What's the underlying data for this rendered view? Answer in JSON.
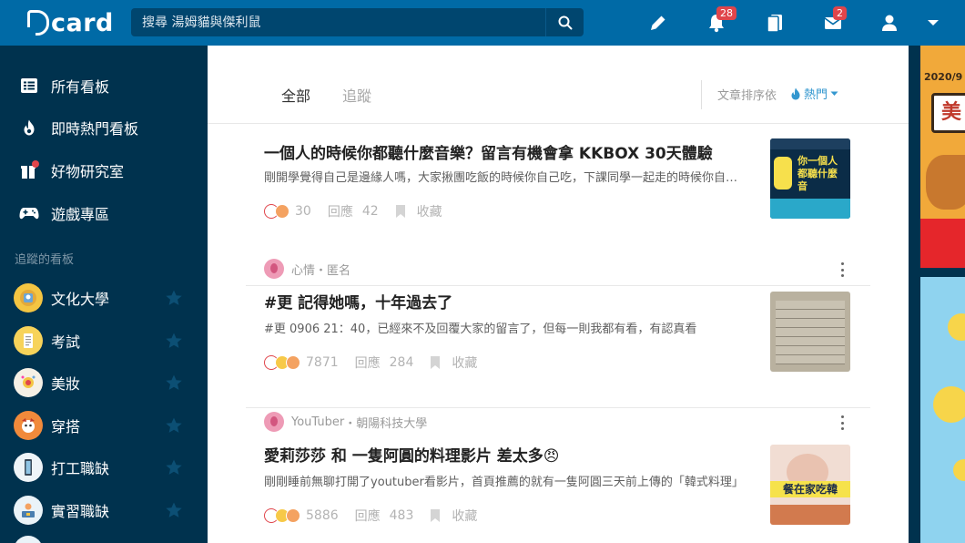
{
  "app": {
    "logo_text": "card"
  },
  "search": {
    "placeholder": "搜尋 湯姆貓與傑利鼠"
  },
  "header": {
    "notifications_count": "28",
    "messages_count": "2"
  },
  "sidebar": {
    "main_items": [
      {
        "label": "所有看板",
        "icon": "list-icon"
      },
      {
        "label": "即時熱門看板",
        "icon": "fire-icon"
      },
      {
        "label": "好物研究室",
        "icon": "gift-icon"
      },
      {
        "label": "遊戲專區",
        "icon": "gamepad-icon"
      }
    ],
    "section_title": "追蹤的看板",
    "forums": [
      {
        "label": "文化大學",
        "color": "#f4c542"
      },
      {
        "label": "考試",
        "color": "#f7d35a"
      },
      {
        "label": "美妝",
        "color": "#f5f0e6"
      },
      {
        "label": "穿搭",
        "color": "#f18a3b"
      },
      {
        "label": "打工職缺",
        "color": "#eef4f8"
      },
      {
        "label": "實習職缺",
        "color": "#eaf3f8"
      }
    ]
  },
  "tabs": {
    "all": "全部",
    "follow": "追蹤"
  },
  "sort": {
    "label": "文章排序依",
    "value": "熱門"
  },
  "posts": [
    {
      "forum": "",
      "author": "",
      "title": "一個人的時候你都聽什麼音樂？留言有機會拿 KKBOX 30天體驗",
      "excerpt": "剛開學覺得自己是邊緣人嗎，大家揪團吃飯的時候你自己吃，下課同學一起走的時候你自己走",
      "likes": "30",
      "reply_label": "回應",
      "comments": "42",
      "save_label": "收藏",
      "thumb_text": "你一個人都聽什麼音"
    },
    {
      "forum": "心情",
      "author": "匿名",
      "title": "#更 記得她嗎，十年過去了",
      "excerpt": "#更 0906 21：40，已經來不及回覆大家的留言了，但每一則我都有看，有認真看",
      "likes": "7871",
      "reply_label": "回應",
      "comments": "284",
      "save_label": "收藏",
      "thumb_text": ""
    },
    {
      "forum": "YouTuber",
      "author": "朝陽科技大學",
      "title": "愛莉莎莎 和 一隻阿圓的料理影片 差太多😠",
      "excerpt": "剛剛睡前無聊打開了youtuber看影片，首頁推薦的就有一隻阿圓三天前上傳的「韓式料理」",
      "likes": "5886",
      "reply_label": "回應",
      "comments": "483",
      "save_label": "收藏",
      "thumb_text": "餐在家吃韓"
    }
  ],
  "ad": {
    "year_text": "2020/9",
    "brand_text": "美"
  },
  "colors": {
    "brand": "#006aa6",
    "sidebar": "#00324e",
    "accent_blue": "#3397cf",
    "badge_red": "#e0454b"
  }
}
